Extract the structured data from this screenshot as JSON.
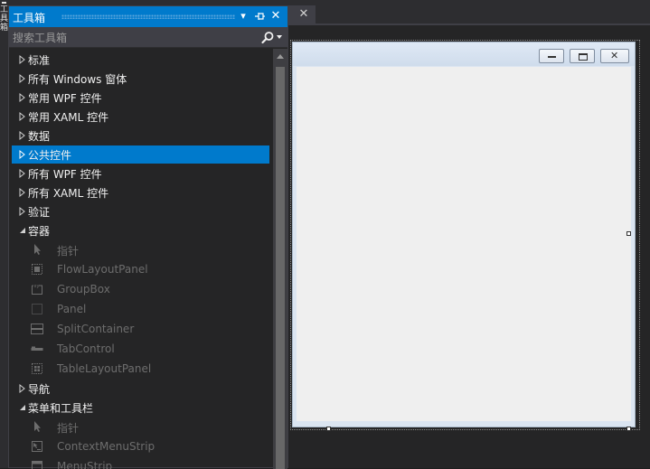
{
  "left_strip": {
    "label": "工具箱"
  },
  "toolbox": {
    "title": "工具箱",
    "search_placeholder": "搜索工具箱",
    "categories_before": [
      {
        "label": "标准",
        "expanded": false,
        "selected": false
      },
      {
        "label": "所有 Windows 窗体",
        "expanded": false,
        "selected": false
      },
      {
        "label": "常用 WPF 控件",
        "expanded": false,
        "selected": false
      },
      {
        "label": "常用 XAML 控件",
        "expanded": false,
        "selected": false
      },
      {
        "label": "数据",
        "expanded": false,
        "selected": false
      },
      {
        "label": "公共控件",
        "expanded": false,
        "selected": true
      },
      {
        "label": "所有 WPF 控件",
        "expanded": false,
        "selected": false
      },
      {
        "label": "所有 XAML 控件",
        "expanded": false,
        "selected": false
      },
      {
        "label": "验证",
        "expanded": false,
        "selected": false
      }
    ],
    "containers": {
      "label": "容器",
      "expanded": true,
      "items": [
        {
          "label": "指针",
          "icon": "pointer-icon"
        },
        {
          "label": "FlowLayoutPanel",
          "icon": "flowlayoutpanel-icon"
        },
        {
          "label": "GroupBox",
          "icon": "groupbox-icon"
        },
        {
          "label": "Panel",
          "icon": "panel-icon"
        },
        {
          "label": "SplitContainer",
          "icon": "splitcontainer-icon"
        },
        {
          "label": "TabControl",
          "icon": "tabcontrol-icon"
        },
        {
          "label": "TableLayoutPanel",
          "icon": "tablelayoutpanel-icon"
        }
      ]
    },
    "navigation": {
      "label": "导航",
      "expanded": false
    },
    "menus": {
      "label": "菜单和工具栏",
      "expanded": true,
      "items": [
        {
          "label": "指针",
          "icon": "pointer-icon"
        },
        {
          "label": "ContextMenuStrip",
          "icon": "contextmenustrip-icon"
        },
        {
          "label": "MenuStrip",
          "icon": "menustrip-icon"
        }
      ]
    }
  },
  "colors": {
    "accent": "#007acc",
    "panel_bg": "#252526",
    "tab_strip_bg": "#2d2d30",
    "form_client": "#efefef",
    "form_titlebar": "#dbe5f1",
    "item_text_disabled": "#6d6d6d"
  }
}
